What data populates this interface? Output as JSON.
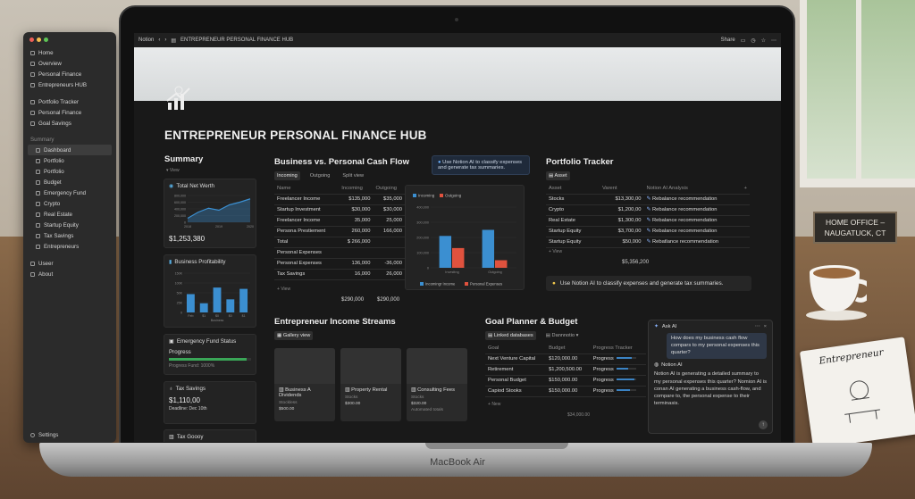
{
  "sidebar": {
    "items_top": [
      {
        "icon": "home-icon",
        "label": "Home"
      },
      {
        "icon": "search-icon",
        "label": "Overview"
      },
      {
        "icon": "page-icon",
        "label": "Personal Finance"
      },
      {
        "icon": "page-icon",
        "label": "Entrepreneurs HUB"
      }
    ],
    "items_mid": [
      {
        "icon": "page-icon",
        "label": "Portfolio Tracker"
      },
      {
        "icon": "page-icon",
        "label": "Personal Finance"
      },
      {
        "icon": "page-icon",
        "label": "Goal Savings"
      }
    ],
    "section_label": "Summary",
    "items_sub": [
      {
        "label": "Dashboard",
        "active": true
      },
      {
        "label": "Portfolio"
      },
      {
        "label": "Portfolio"
      },
      {
        "label": "Budget"
      },
      {
        "label": "Emergency Fund"
      },
      {
        "label": "Crypto"
      },
      {
        "label": "Real Estate"
      },
      {
        "label": "Startup Equity"
      },
      {
        "label": "Tax Savings"
      },
      {
        "label": "Entrepreneurs"
      }
    ],
    "items_bottom": [
      {
        "label": "Useer"
      },
      {
        "label": "About"
      }
    ],
    "settings": "Settings"
  },
  "topbar": {
    "app": "Notion",
    "breadcrumb": "ENTREPRENEUR PERSONAL FINANCE HUB",
    "share": "Share"
  },
  "page": {
    "title": "ENTREPRENEUR PERSONAL FINANCE HUB"
  },
  "summary": {
    "title": "Summary",
    "view": "View",
    "net_worth": {
      "label": "Total Net Werth",
      "value": "$1,253,380",
      "x": [
        "2018",
        "2019",
        "2020"
      ],
      "y": [
        "800,000",
        "600,000",
        "400,000",
        "200,000",
        "0"
      ]
    },
    "profitability": {
      "label": "Business Profitability",
      "y": [
        "150K",
        "100K",
        "50K",
        "25K",
        "0"
      ],
      "x": [
        "Feb",
        "$1",
        "$0",
        "$0",
        "$1"
      ],
      "xlabel": "Business"
    },
    "emergency": {
      "label": "Emergency Fund Status",
      "progress_label": "Progress",
      "sub": "Progress Fund: 1000%",
      "progress": 0.95
    },
    "tax": {
      "label": "Tax Savings",
      "value": "$1,110,00",
      "deadline": "Deadline: Dec 10th"
    },
    "tax2": {
      "label": "Tax Goooy"
    }
  },
  "cashflow": {
    "title": "Business vs. Personal Cash Flow",
    "tabs": [
      "Incoming",
      "Outgoing",
      "Split view"
    ],
    "columns": [
      "Name",
      "Incoming",
      "Outgoing"
    ],
    "rows": [
      {
        "name": "Freelancer Income",
        "in": "$135,000",
        "out": "$35,000"
      },
      {
        "name": "Startup Investment",
        "in": "$30,000",
        "out": "$30,000"
      },
      {
        "name": "Freelancer Income",
        "in": "35,000",
        "out": "25,000"
      },
      {
        "name": "Persona Prestiement",
        "in": "260,000",
        "out": "166,000"
      },
      {
        "name": "Total",
        "in": "$ 266,000",
        "out": ""
      },
      {
        "name": "Personal Expenses",
        "in": "",
        "out": ""
      },
      {
        "name": "Personal Expenses",
        "in": "136,000",
        "out": "-36,000",
        "red": true
      },
      {
        "name": "Tax Savings",
        "in": "16,000",
        "out": "26,000",
        "red": true
      }
    ],
    "view": "View",
    "totals": {
      "in": "$290,000",
      "out": "$290,000"
    },
    "ai_popup": "Use Notion AI to classify expenses and generate tax summaries."
  },
  "split_chart": {
    "legend": [
      "Incoming",
      "Outgoing"
    ],
    "y": [
      "400,000",
      "300,000",
      "200,000",
      "100,000",
      "0"
    ],
    "x": [
      "Investtng",
      "Outgoing"
    ],
    "bottom_legend": [
      "Incomingr Income",
      "Personal Expenses"
    ]
  },
  "chart_data": [
    {
      "type": "area",
      "title": "Total Net Werth",
      "x": [
        "2018",
        "2019",
        "2020"
      ],
      "values": [
        120000,
        300000,
        420000,
        360000,
        520000,
        600000,
        700000
      ],
      "ylim": [
        0,
        800000
      ]
    },
    {
      "type": "bar",
      "title": "Business Profitability",
      "categories": [
        "Feb",
        "$1",
        "$0",
        "$0",
        "$1"
      ],
      "values": [
        70,
        35,
        95,
        50,
        90
      ],
      "ylim": [
        0,
        150
      ]
    },
    {
      "type": "bar",
      "categories": [
        "Investtng",
        "Outgoing"
      ],
      "series": [
        {
          "name": "Incoming",
          "values": [
            210000,
            250000
          ]
        },
        {
          "name": "Outgoing",
          "values": [
            130000,
            50000
          ]
        }
      ],
      "ylim": [
        0,
        400000
      ]
    }
  ],
  "portfolio": {
    "title": "Portfolio Tracker",
    "tab": "Asset",
    "columns": [
      "Asset",
      "Varent",
      "Notion AI Analysis"
    ],
    "rows": [
      {
        "a": "Stocks",
        "v": "$13,300,00",
        "n": "Rebalance recommendation"
      },
      {
        "a": "Crypto",
        "v": "$1,200,00",
        "n": "Rebalance recommendation"
      },
      {
        "a": "Real Estate",
        "v": "$1,300,00",
        "n": "Rebalance recommendation"
      },
      {
        "a": "Startup Equity",
        "v": "$3,700,00",
        "n": "Rebalance recommendation"
      },
      {
        "a": "Startup Equity",
        "v": "$50,000",
        "n": "Rebatlance recommendation"
      }
    ],
    "view": "View",
    "total": "$5,356,200"
  },
  "callout": "Use Notion AI to classify expenses and generate tax summaries.",
  "streams": {
    "title": "Entrepreneur Income Streams",
    "tab": "Gallery view",
    "cards": [
      {
        "t": "Business A Dividends",
        "s1": "Stockless",
        "s2": "$500.00"
      },
      {
        "t": "Property Rental",
        "s1": "Stocks",
        "s2": "$300.00"
      },
      {
        "t": "Consulting Fees",
        "s1": "Stocks",
        "s2": "$320.00",
        "s3": "Automated totals"
      }
    ]
  },
  "goals": {
    "title": "Goal Planner & Budget",
    "tabs": [
      "Linked databases",
      "Dannnotio"
    ],
    "columns": [
      "Goal",
      "Budget",
      "Progress Tracker"
    ],
    "rows": [
      {
        "g": "Next Venture Capital",
        "b": "$120,000.00",
        "p": "Progress",
        "v": 0.8
      },
      {
        "g": "Retirement",
        "b": "$1,200,500.00",
        "p": "Progress",
        "v": 0.6
      },
      {
        "g": "Personal Budget",
        "b": "$150,000.00",
        "p": "Progress",
        "v": 0.9
      },
      {
        "g": "Capiod Stooks",
        "b": "$150,000.00",
        "p": "Progress",
        "v": 0.7
      }
    ],
    "new": "New",
    "total": "$34,000.00"
  },
  "askai": {
    "title": "Ask AI",
    "question": "How does my business cash flow compars to my personal expenses this quarter?",
    "responder": "Notion AI",
    "answer": "Notion AI is generating a detailed summary to my personal expenses this quarter? Nomion AI is conan AI generating a business cash-flow, and compare to, the personal expense to their terminasis."
  },
  "scene": {
    "laptop_brand": "MacBook Air",
    "sign": [
      "HOME OFFICE –",
      "NAUGATUCK, CT"
    ],
    "notebook_text": "Entrepreneur"
  },
  "colors": {
    "accent": "#3b8fd1",
    "red": "#e0523e",
    "bg": "#191919",
    "panel": "#232323"
  }
}
